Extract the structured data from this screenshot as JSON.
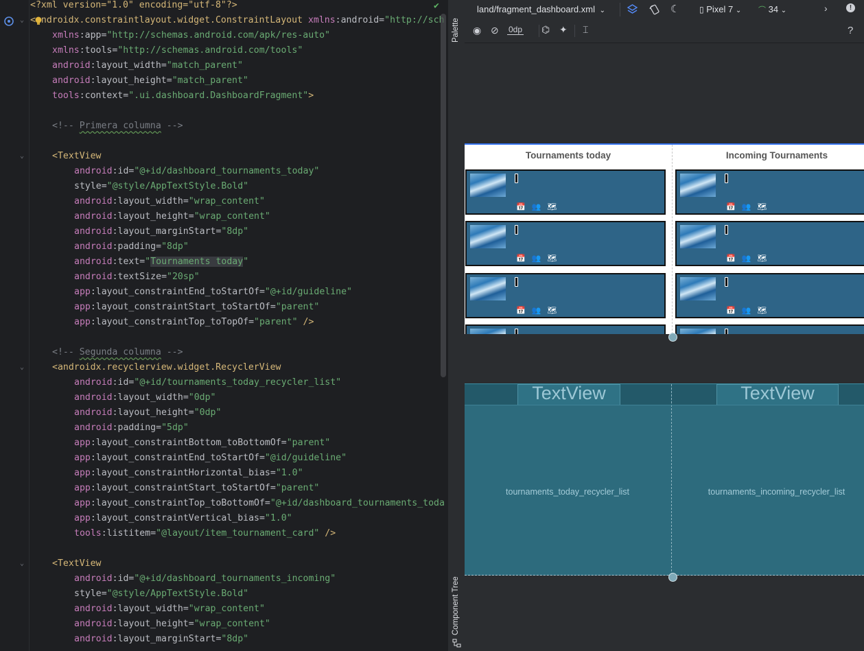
{
  "editor": {
    "lines": [
      {
        "t": "<?xml version=\"1.0\" encoding=\"utf-8\"?>",
        "k": "pi"
      },
      {
        "t": "<androidx.constraintlayout.widget.ConstraintLayout xmlns:android=\"http://sch",
        "k": "root"
      },
      {
        "t": "xmlns:app=\"http://schemas.android.com/apk/res-auto\"",
        "k": "a1"
      },
      {
        "t": "xmlns:tools=\"http://schemas.android.com/tools\"",
        "k": "a1"
      },
      {
        "t": "android:layout_width=\"match_parent\"",
        "k": "a1"
      },
      {
        "t": "android:layout_height=\"match_parent\"",
        "k": "a1"
      },
      {
        "t": "tools:context=\".ui.dashboard.DashboardFragment\">",
        "k": "a1"
      },
      {
        "t": "",
        "k": "blank"
      },
      {
        "t": "<!-- Primera columna -->",
        "k": "c1"
      },
      {
        "t": "",
        "k": "blank"
      },
      {
        "t": "<TextView",
        "k": "t1"
      },
      {
        "t": "android:id=\"@+id/dashboard_tournaments_today\"",
        "k": "a2"
      },
      {
        "t": "style=\"@style/AppTextStyle.Bold\"",
        "k": "a2"
      },
      {
        "t": "android:layout_width=\"wrap_content\"",
        "k": "a2"
      },
      {
        "t": "android:layout_height=\"wrap_content\"",
        "k": "a2"
      },
      {
        "t": "android:layout_marginStart=\"8dp\"",
        "k": "a2"
      },
      {
        "t": "android:padding=\"8dp\"",
        "k": "a2"
      },
      {
        "t": "android:text=\"Tournaments today\"",
        "k": "a2hl"
      },
      {
        "t": "android:textSize=\"20sp\"",
        "k": "a2"
      },
      {
        "t": "app:layout_constraintEnd_toStartOf=\"@+id/guideline\"",
        "k": "a2"
      },
      {
        "t": "app:layout_constraintStart_toStartOf=\"parent\"",
        "k": "a2"
      },
      {
        "t": "app:layout_constraintTop_toTopOf=\"parent\" />",
        "k": "a2"
      },
      {
        "t": "",
        "k": "blank"
      },
      {
        "t": "<!-- Segunda columna -->",
        "k": "c1"
      },
      {
        "t": "<androidx.recyclerview.widget.RecyclerView",
        "k": "t1"
      },
      {
        "t": "android:id=\"@+id/tournaments_today_recycler_list\"",
        "k": "a2"
      },
      {
        "t": "android:layout_width=\"0dp\"",
        "k": "a2"
      },
      {
        "t": "android:layout_height=\"0dp\"",
        "k": "a2"
      },
      {
        "t": "android:padding=\"5dp\"",
        "k": "a2"
      },
      {
        "t": "app:layout_constraintBottom_toBottomOf=\"parent\"",
        "k": "a2"
      },
      {
        "t": "app:layout_constraintEnd_toStartOf=\"@id/guideline\"",
        "k": "a2"
      },
      {
        "t": "app:layout_constraintHorizontal_bias=\"1.0\"",
        "k": "a2"
      },
      {
        "t": "app:layout_constraintStart_toStartOf=\"parent\"",
        "k": "a2"
      },
      {
        "t": "app:layout_constraintTop_toBottomOf=\"@+id/dashboard_tournaments_toda",
        "k": "a2"
      },
      {
        "t": "app:layout_constraintVertical_bias=\"1.0\"",
        "k": "a2"
      },
      {
        "t": "tools:listitem=\"@layout/item_tournament_card\" />",
        "k": "a2"
      },
      {
        "t": "",
        "k": "blank"
      },
      {
        "t": "<TextView",
        "k": "t1"
      },
      {
        "t": "android:id=\"@+id/dashboard_tournaments_incoming\"",
        "k": "a2"
      },
      {
        "t": "style=\"@style/AppTextStyle.Bold\"",
        "k": "a2"
      },
      {
        "t": "android:layout_width=\"wrap_content\"",
        "k": "a2"
      },
      {
        "t": "android:layout_height=\"wrap_content\"",
        "k": "a2"
      },
      {
        "t": "android:layout_marginStart=\"8dp\"",
        "k": "a2"
      }
    ]
  },
  "strip": {
    "palette": "Palette",
    "component_tree": "Component Tree"
  },
  "topbar": {
    "file": "land/fragment_dashboard.xml",
    "device": "Pixel 7",
    "api": "34"
  },
  "toolbar": {
    "margin": "0dp",
    "help": "?"
  },
  "preview": {
    "left_title": "Tournaments today",
    "right_title": "Incoming Tournaments",
    "card_icons": "📅👥🗺"
  },
  "blueprint": {
    "tv_left": "TextView",
    "tv_right": "TextView",
    "left_list": "tournaments_today_recycler_list",
    "right_list": "tournaments_incoming_recycler_list"
  },
  "colors": {
    "accent": "#3574f0",
    "card": "#2e6487",
    "blueprint": "#2d6b7d"
  }
}
